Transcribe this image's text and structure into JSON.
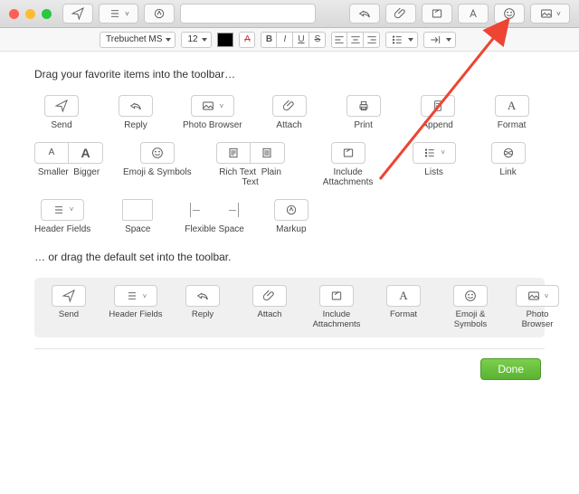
{
  "font_family": "Trebuchet MS",
  "font_size": "12",
  "heading_available": "Drag your favorite items into the toolbar…",
  "heading_default": "… or drag the default set into the toolbar.",
  "done": "Done",
  "items": {
    "send": "Send",
    "reply": "Reply",
    "photo_browser": "Photo Browser",
    "attach": "Attach",
    "print": "Print",
    "append": "Append",
    "format": "Format",
    "smaller": "Smaller",
    "bigger": "Bigger",
    "emoji": "Emoji & Symbols",
    "rich_text": "Rich Text",
    "plain_text": "Plain Text",
    "include_attachments": "Include Attachments",
    "lists": "Lists",
    "link": "Link",
    "header_fields": "Header Fields",
    "space": "Space",
    "flexible_space": "Flexible Space",
    "markup": "Markup"
  },
  "glyph": {
    "A_big": "A",
    "A_small": "A"
  }
}
